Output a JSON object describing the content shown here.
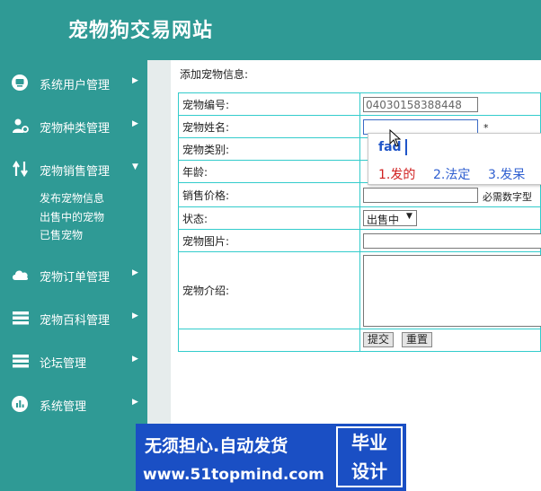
{
  "site": {
    "title": "宠物狗交易网站"
  },
  "sidebar": {
    "items": [
      {
        "label": "系统用户管理",
        "icon": "monitor-icon"
      },
      {
        "label": "宠物种类管理",
        "icon": "users-gear-icon"
      },
      {
        "label": "宠物销售管理",
        "icon": "exchange-icon",
        "expanded": true,
        "children": [
          "发布宠物信息",
          "出售中的宠物",
          "已售宠物"
        ]
      },
      {
        "label": "宠物订单管理",
        "icon": "cloud-icon"
      },
      {
        "label": "宠物百科管理",
        "icon": "stack-icon"
      },
      {
        "label": "论坛管理",
        "icon": "stack-icon"
      },
      {
        "label": "系统管理",
        "icon": "bar-chart-icon"
      }
    ]
  },
  "form": {
    "title": "添加宠物信息:",
    "labels": {
      "number": "宠物编号:",
      "name": "宠物姓名:",
      "category": "宠物类别:",
      "age": "年龄:",
      "price": "销售价格:",
      "status": "状态:",
      "image": "宠物图片:",
      "intro": "宠物介绍:"
    },
    "values": {
      "number": "04030158388448",
      "name": "",
      "price": "",
      "status": "出售中"
    },
    "required_mark": "*",
    "price_hint": "必需数字型",
    "buttons": {
      "submit": "提交",
      "reset": "重置"
    }
  },
  "ime": {
    "input": "fad",
    "candidates": [
      "1.发的",
      "2.法定",
      "3.发呆"
    ],
    "colors": {
      "first": "#d02020",
      "other": "#2f5fd0"
    }
  },
  "banner": {
    "line1": "无须担心.自动发货",
    "line2": "www.51topmind.com",
    "tag_line1": "毕业",
    "tag_line2": "设计"
  },
  "colors": {
    "accent": "#2f9a95",
    "table_border": "#33cccc",
    "banner": "#1a4fc4"
  }
}
